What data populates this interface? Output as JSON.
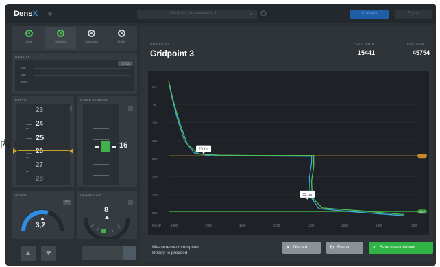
{
  "app": {
    "name_main": "Dens",
    "name_accent": "X"
  },
  "topbar": {
    "project_tab": "Gridpoint Measurement 3",
    "primary_button": "Connect",
    "secondary_button": "Export"
  },
  "modes": [
    {
      "label": "Lens",
      "icon": "target-icon",
      "active": false
    },
    {
      "label": "Gridpoint",
      "icon": "target-active-icon",
      "active": true
    },
    {
      "label": "Calibration",
      "icon": "calibration-icon",
      "active": false
    },
    {
      "label": "Profile",
      "icon": "profile-icon",
      "active": false
    }
  ],
  "density": {
    "title": "DENSITY",
    "button": "DETAIL",
    "rows": [
      "100",
      "500",
      "1000"
    ]
  },
  "depth": {
    "title": "DEPTH",
    "values": [
      "23",
      "24",
      "25",
      "26",
      "27",
      "28"
    ],
    "current": "25"
  },
  "tension": {
    "title": "CABLE TENSION",
    "value": "16"
  },
  "speed": {
    "title": "SPEED",
    "value": "3,2",
    "button": "M/S"
  },
  "inclination": {
    "title": "INCLINATION",
    "value": "8"
  },
  "gridpoint": {
    "label": "GRIDPOINT",
    "name": "Gridpoint 3"
  },
  "position_x": {
    "label": "POSITION X",
    "value": "15441"
  },
  "position_y": {
    "label": "POSITION Y",
    "value": "45754"
  },
  "chart_data": {
    "type": "line",
    "ylabel": "",
    "xlabel": "KG/M³",
    "y_ticks": [
      "0m",
      "7m",
      "10m",
      "15m",
      "20m",
      "25m",
      "30m",
      "35m"
    ],
    "x_ticks": [
      "1000",
      "1050",
      "1100",
      "1150",
      "1200",
      "1250",
      "1300",
      "1350"
    ],
    "markers": [
      {
        "label": "20,1m",
        "depth": 20.1
      },
      {
        "label": "33,1m",
        "depth": 33.1
      }
    ],
    "reference_lines": [
      {
        "depth": 20.2,
        "color": "#c98a2c",
        "tag": ""
      },
      {
        "depth": 35.2,
        "color": "#3a9a42",
        "tag": "33.2"
      }
    ],
    "series": [
      {
        "color": "#3ba6d9",
        "points": [
          [
            1000,
            0
          ],
          [
            1004,
            4
          ],
          [
            1012,
            10
          ],
          [
            1022,
            16
          ],
          [
            1036,
            19.4
          ],
          [
            1060,
            20.2
          ],
          [
            1100,
            20.2
          ],
          [
            1200,
            20.3
          ],
          [
            1200,
            22
          ],
          [
            1197,
            26
          ],
          [
            1198,
            31
          ],
          [
            1210,
            34.4
          ],
          [
            1260,
            35.3
          ],
          [
            1330,
            36.3
          ]
        ]
      },
      {
        "color": "#4fbf5a",
        "points": [
          [
            1000,
            0
          ],
          [
            1006,
            5
          ],
          [
            1015,
            11
          ],
          [
            1026,
            17
          ],
          [
            1042,
            19.7
          ],
          [
            1070,
            20.0
          ],
          [
            1120,
            20.1
          ],
          [
            1203,
            20.1
          ],
          [
            1203,
            23
          ],
          [
            1200,
            27
          ],
          [
            1201,
            31.5
          ],
          [
            1215,
            34.2
          ],
          [
            1270,
            35.0
          ],
          [
            1330,
            36.0
          ]
        ]
      }
    ]
  },
  "status": {
    "line1": "Measurement complete",
    "line2": "Ready to proceed"
  },
  "actions": {
    "discard": "Discard",
    "restart": "Restart",
    "save": "Save measurement"
  },
  "overlay": {
    "text": "内 ）"
  },
  "colors": {
    "accent": "#2f8de4",
    "success": "#31b547",
    "orange": "#c98a2c"
  }
}
